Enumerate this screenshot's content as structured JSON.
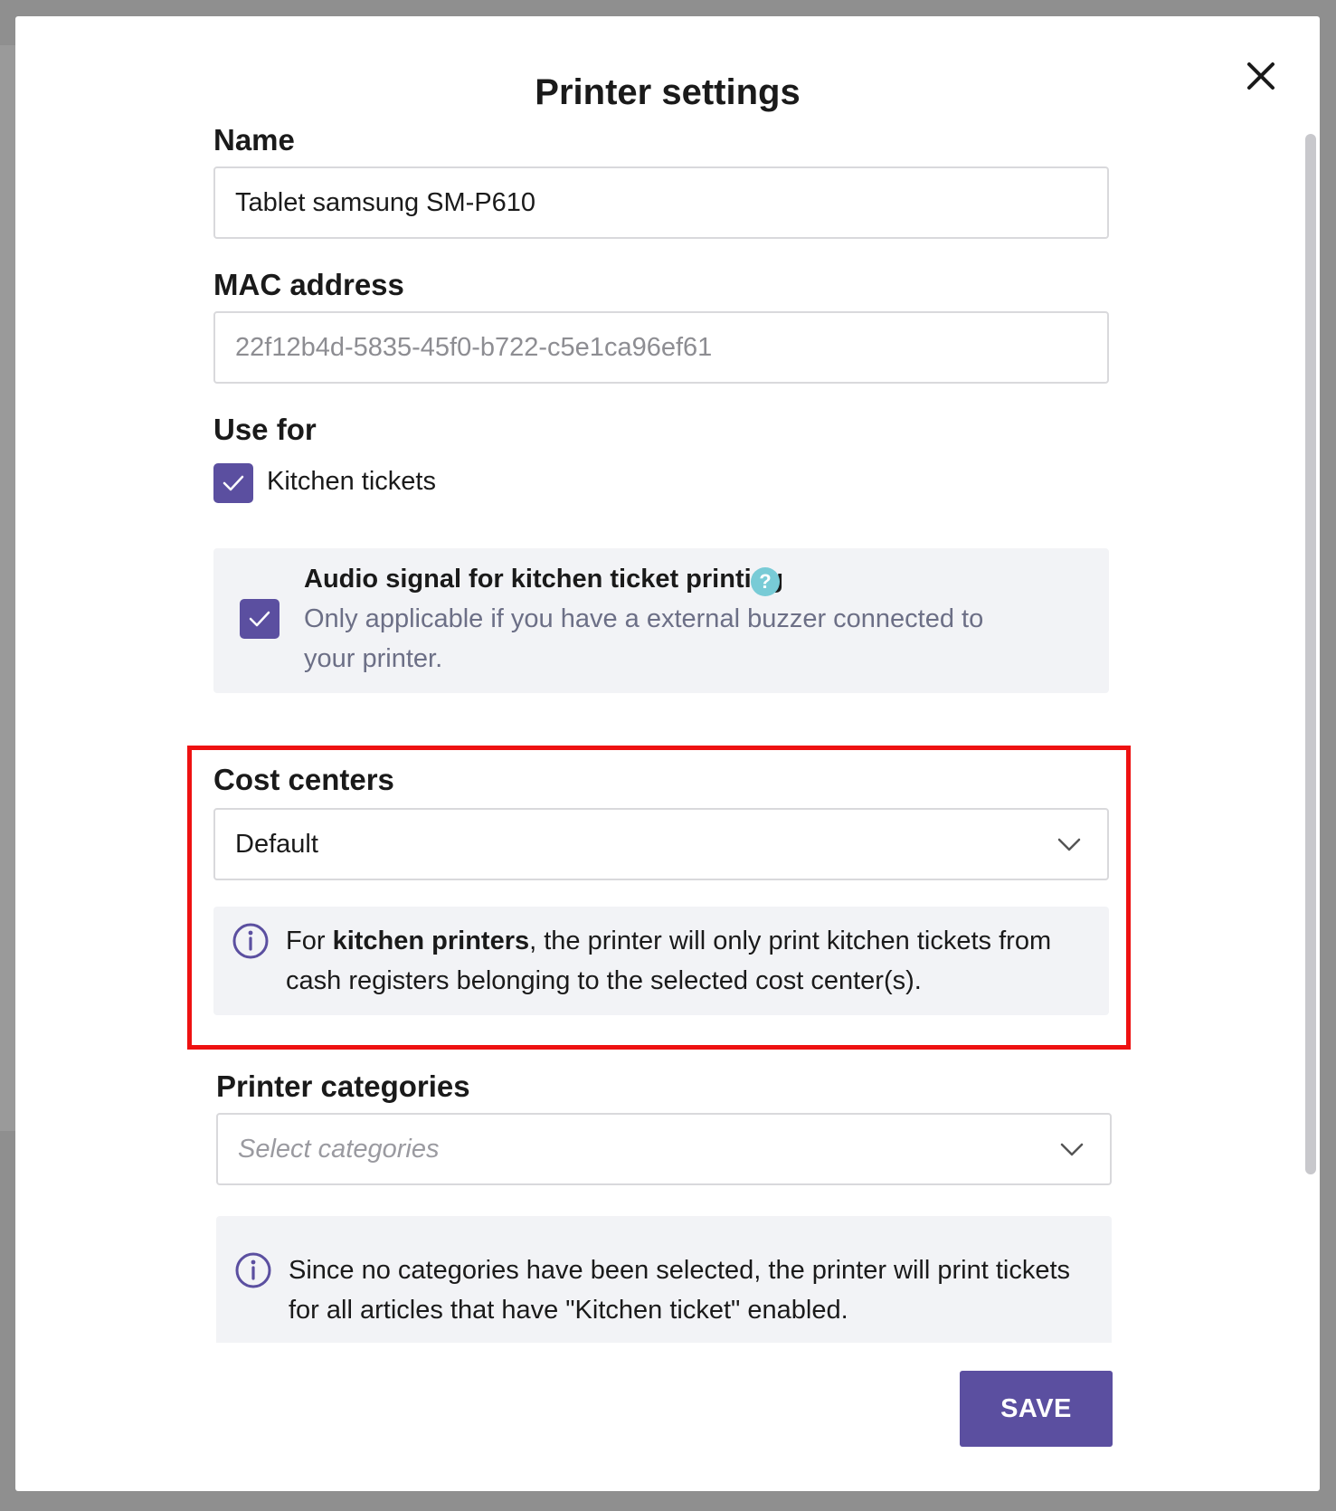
{
  "dialog": {
    "title": "Printer settings",
    "close_icon": "close-icon"
  },
  "name_field": {
    "label": "Name",
    "value": "Tablet samsung SM-P610"
  },
  "mac_field": {
    "label": "MAC address",
    "value": "22f12b4d-5835-45f0-b722-c5e1ca96ef61"
  },
  "use_for": {
    "label": "Use for",
    "kitchen_tickets": {
      "label": "Kitchen tickets",
      "checked": true
    }
  },
  "audio_signal": {
    "checked": true,
    "title": "Audio signal for kitchen ticket printing",
    "help_icon": "?",
    "description": "Only applicable if you have a external buzzer connected to your printer."
  },
  "cost_centers": {
    "label": "Cost centers",
    "selected": "Default",
    "info_prefix": "For ",
    "info_bold": "kitchen printers",
    "info_suffix": ", the printer will only print kitchen tickets from cash registers belonging to the selected cost center(s)."
  },
  "printer_categories": {
    "label": "Printer categories",
    "placeholder": "Select categories",
    "info": "Since no categories have been selected, the printer will print tickets for all articles that have \"Kitchen ticket\" enabled."
  },
  "footer": {
    "save_label": "SAVE"
  },
  "colors": {
    "accent": "#5b4fa0",
    "highlight_border": "#ee1111",
    "help_badge": "#78cbd6",
    "info_panel": "#f2f3f6"
  }
}
